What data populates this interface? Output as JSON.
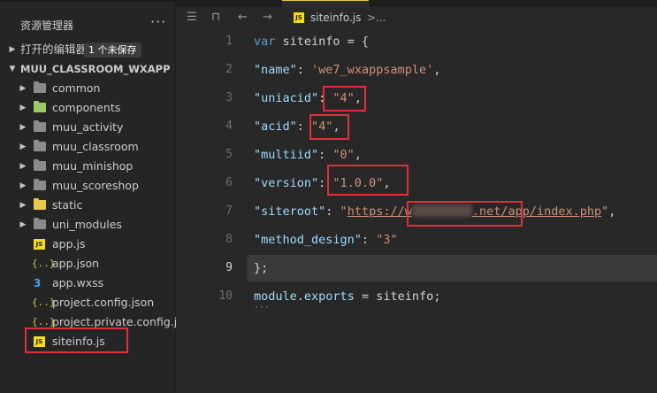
{
  "sidebar": {
    "title": "资源管理器",
    "more": "···",
    "open_editors": {
      "label": "打开的编辑器",
      "badge": "1 个未保存"
    },
    "project": {
      "label": "MUU_CLASSROOM_WXAPP"
    },
    "folders": [
      "common",
      "components",
      "muu_activity",
      "muu_classroom",
      "muu_minishop",
      "muu_scoreshop",
      "static",
      "uni_modules"
    ],
    "files": [
      "app.js",
      "app.json",
      "app.wxss",
      "project.config.json",
      "project.private.config.js...",
      "siteinfo.js"
    ],
    "file_icons": {
      "js": "JS",
      "json": "{..}",
      "css": "3"
    }
  },
  "breadcrumb": {
    "file": "siteinfo.js",
    "sep": ">",
    "more": "..."
  },
  "editor": {
    "line_numbers": [
      "1",
      "2",
      "3",
      "4",
      "5",
      "6",
      "7",
      "8",
      "9",
      "10"
    ],
    "l1": {
      "kw": "var",
      "rest": " siteinfo = {"
    },
    "l2": {
      "key": "\"name\"",
      "colon": ": ",
      "val": "'we7_wxappsample'",
      "end": ","
    },
    "l3": {
      "key": "\"uniacid\"",
      "colon": ": ",
      "val": "\"4\"",
      "end": ","
    },
    "l4": {
      "key": "\"acid\"",
      "colon": ": ",
      "val": "\"4\"",
      "end": ","
    },
    "l5": {
      "key": "\"multiid\"",
      "colon": ": ",
      "val": "\"0\"",
      "end": ","
    },
    "l6": {
      "key": "\"version\"",
      "colon": ": ",
      "val": "\"1.0.0\"",
      "end": ","
    },
    "l7": {
      "key": "\"siteroot\"",
      "colon": ": ",
      "q1": "\"",
      "url_a": "https://w",
      "url_b": ".net/app/index.php",
      "q2": "\"",
      "end": ","
    },
    "l8": {
      "key": "\"method_design\"",
      "colon": ": ",
      "val": "\"3\""
    },
    "l9": {
      "text": "};"
    },
    "l10": {
      "a": "module",
      "b": ".",
      "c": "exports",
      "d": " = siteinfo;"
    },
    "hint": "···"
  },
  "colors": {
    "highlight_box": "#e02f3b",
    "keyword": "#569cd6",
    "key": "#9cdcfe",
    "string": "#ce9178"
  }
}
